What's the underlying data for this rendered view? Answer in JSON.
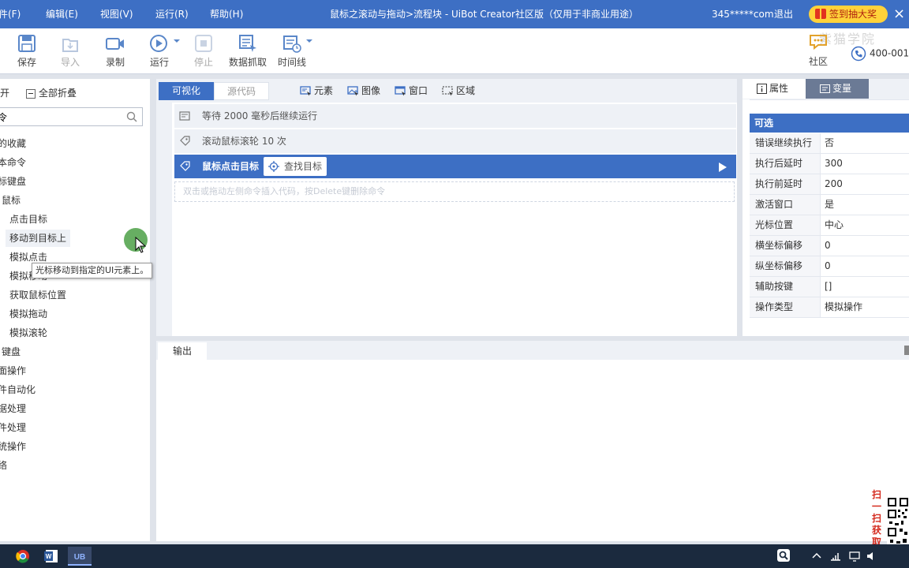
{
  "titlebar": {
    "menus": [
      "件(F)",
      "编辑(E)",
      "视图(V)",
      "运行(R)",
      "帮助(H)"
    ],
    "title": "鼠标之滚动与拖动>流程块 - UiBot Creator社区版（仅用于非商业用途）",
    "account": "345*****com",
    "logout": "退出",
    "lottery": "签到抽大奖",
    "close": "×"
  },
  "toolbar": {
    "buttons": [
      {
        "label": "保存",
        "icon": "save-icon",
        "enabled": true
      },
      {
        "label": "导入",
        "icon": "import-icon",
        "enabled": false
      },
      {
        "label": "录制",
        "icon": "record-icon",
        "enabled": true
      },
      {
        "label": "运行",
        "icon": "run-icon",
        "enabled": true
      },
      {
        "label": "停止",
        "icon": "stop-icon",
        "enabled": false
      },
      {
        "label": "数据抓取",
        "icon": "data-scrape-icon",
        "enabled": true
      },
      {
        "label": "时间线",
        "icon": "timeline-icon",
        "enabled": true
      }
    ],
    "community": "社区",
    "phone": "400-001",
    "watermark": "紫猫学院"
  },
  "leftpanel": {
    "expand_all": "展开",
    "collapse_all": "全部折叠",
    "search_value": "令",
    "tree": [
      {
        "label": "的收藏",
        "level": 0
      },
      {
        "label": "本命令",
        "level": 0
      },
      {
        "label": "标键盘",
        "level": 0
      },
      {
        "label": "鼠标",
        "level": 0
      },
      {
        "label": "点击目标",
        "level": 1
      },
      {
        "label": "移动到目标上",
        "level": 1,
        "highlight": true
      },
      {
        "label": "模拟点击",
        "level": 1
      },
      {
        "label": "模拟移动",
        "level": 1
      },
      {
        "label": "获取鼠标位置",
        "level": 1
      },
      {
        "label": "模拟拖动",
        "level": 1
      },
      {
        "label": "模拟滚轮",
        "level": 1
      },
      {
        "label": "键盘",
        "level": 0
      },
      {
        "label": "面操作",
        "level": 0
      },
      {
        "label": "件自动化",
        "level": 0
      },
      {
        "label": "据处理",
        "level": 0
      },
      {
        "label": "件处理",
        "level": 0
      },
      {
        "label": "统操作",
        "level": 0
      },
      {
        "label": "络",
        "level": 0
      }
    ],
    "tooltip": "光标移动到指定的UI元素上。"
  },
  "editor": {
    "tab_visual": "可视化",
    "tab_source": "源代码",
    "pickers": [
      "元素",
      "图像",
      "窗口",
      "区域"
    ],
    "commands": [
      {
        "text": "等待 2000 毫秒后继续运行",
        "icon": "delay-icon",
        "selected": false
      },
      {
        "text": "滚动鼠标滚轮 10 次",
        "icon": "mouse-tag-icon",
        "selected": false
      },
      {
        "text": "鼠标点击目标",
        "icon": "mouse-tag-icon",
        "selected": true
      }
    ],
    "find_target": "查找目标",
    "drop_hint": "双击或拖动左侧命令插入代码，按Delete键删除命令"
  },
  "rightpanel": {
    "tab_props": "属性",
    "tab_vars": "变量",
    "section": "可选",
    "rows": [
      {
        "key": "错误继续执行",
        "value": "否"
      },
      {
        "key": "执行后延时",
        "value": "300"
      },
      {
        "key": "执行前延时",
        "value": "200"
      },
      {
        "key": "激活窗口",
        "value": "是"
      },
      {
        "key": "光标位置",
        "value": "中心"
      },
      {
        "key": "横坐标偏移",
        "value": "0"
      },
      {
        "key": "纵坐标偏移",
        "value": "0"
      },
      {
        "key": "辅助按键",
        "value": "[]"
      },
      {
        "key": "操作类型",
        "value": "模拟操作"
      }
    ]
  },
  "output": {
    "tab": "输出"
  },
  "promo": {
    "text": "扫一扫获取教程"
  },
  "colors": {
    "accent": "#3d6fc4",
    "lottery_bg": "#ffd23a",
    "taskbar": "#1b2a3e"
  }
}
